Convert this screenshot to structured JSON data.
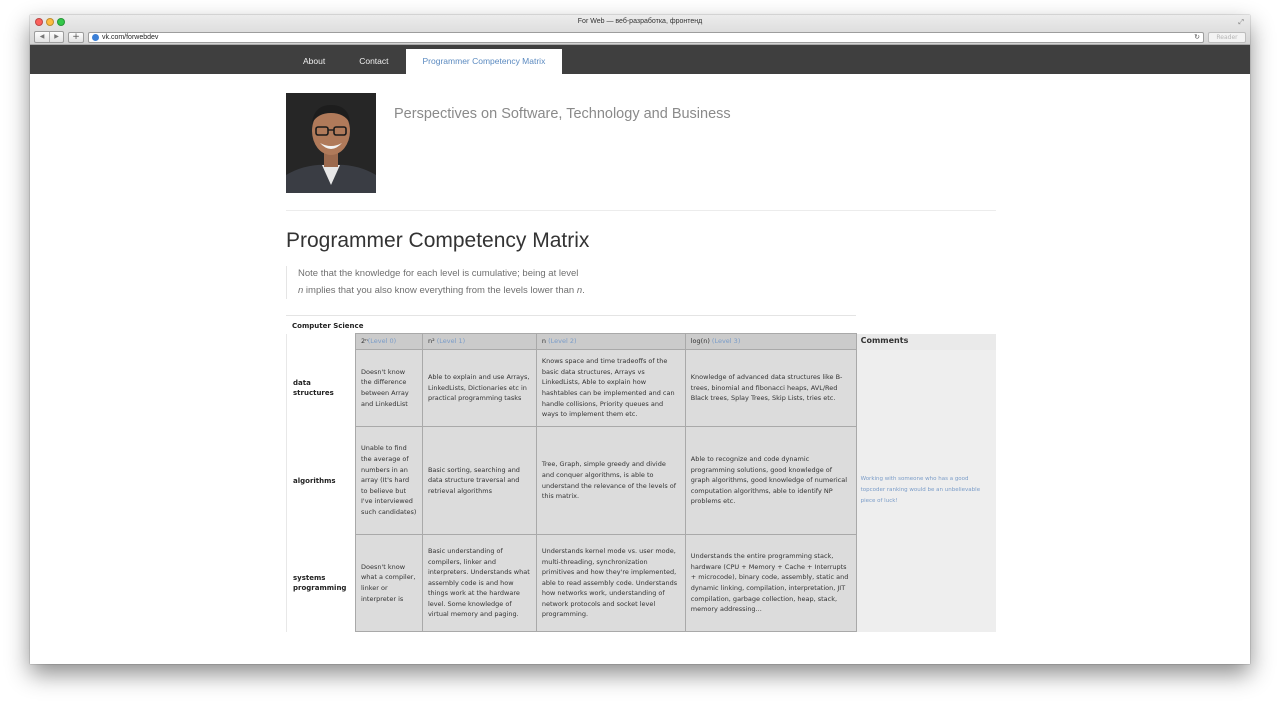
{
  "window": {
    "title": "For Web — веб-разработка, фронтенд",
    "url": "vk.com/forwebdev",
    "reader_label": "Reader"
  },
  "nav": {
    "items": [
      "About",
      "Contact",
      "Programmer Competency Matrix"
    ],
    "active_index": 2
  },
  "site": {
    "tagline": "Perspectives on Software, Technology and Business"
  },
  "page": {
    "title": "Programmer Competency Matrix",
    "note_prefix": "Note that the knowledge for each level is cumulative; being at level ",
    "note_n1": "n",
    "note_middle": " implies that you also know everything from the levels lower than ",
    "note_n2": "n",
    "note_suffix": "."
  },
  "matrix": {
    "section": "Computer Science",
    "headers": [
      {
        "prefix": "2ⁿ",
        "level": "(Level 0)"
      },
      {
        "prefix": "n² ",
        "level": "(Level 1)"
      },
      {
        "prefix": "n ",
        "level": "(Level 2)"
      },
      {
        "prefix": "log(n) ",
        "level": "(Level 3)"
      }
    ],
    "comments_header": "Comments",
    "rows": [
      {
        "label": "data structures",
        "cells": [
          "Doesn't know the difference between Array and LinkedList",
          "Able to explain and use Arrays, LinkedLists, Dictionaries etc in practical programming tasks",
          "Knows space and time tradeoffs of the basic data structures, Arrays vs LinkedLists, Able to explain how hashtables can be implemented and can handle collisions, Priority queues and ways to implement them etc.",
          "Knowledge of advanced data structures like B-trees, binomial and fibonacci heaps, AVL/Red Black trees, Splay Trees, Skip Lists, tries etc."
        ]
      },
      {
        "label": "algorithms",
        "cells": [
          "Unable to find the average of numbers in an array (It's hard to believe but I've interviewed such candidates)",
          "Basic sorting, searching and data structure traversal and retrieval algorithms",
          "Tree, Graph, simple greedy and divide and conquer algorithms, is able to understand the relevance of the levels of this matrix.",
          "Able to recognize and code dynamic programming solutions, good knowledge of graph algorithms, good knowledge of numerical computation algorithms, able to identify NP problems etc."
        ]
      },
      {
        "label": "systems programming",
        "cells": [
          "Doesn't know what a compiler, linker or interpreter is",
          "Basic understanding of compilers, linker and interpreters. Understands what assembly code is and how things work at the hardware level. Some knowledge of virtual memory and paging.",
          "Understands kernel mode vs. user mode, multi-threading, synchronization primitives and how they're implemented, able to read assembly code. Understands how networks work, understanding of network protocols and socket level programming.",
          "Understands the entire programming stack, hardware (CPU + Memory + Cache + Interrupts + microcode), binary code, assembly, static and dynamic linking, compilation, interpretation, JIT compilation, garbage collection, heap, stack, memory addressing..."
        ]
      }
    ],
    "comment": "Working with someone who has a good topcoder ranking would be an unbelievable piece of luck!"
  }
}
